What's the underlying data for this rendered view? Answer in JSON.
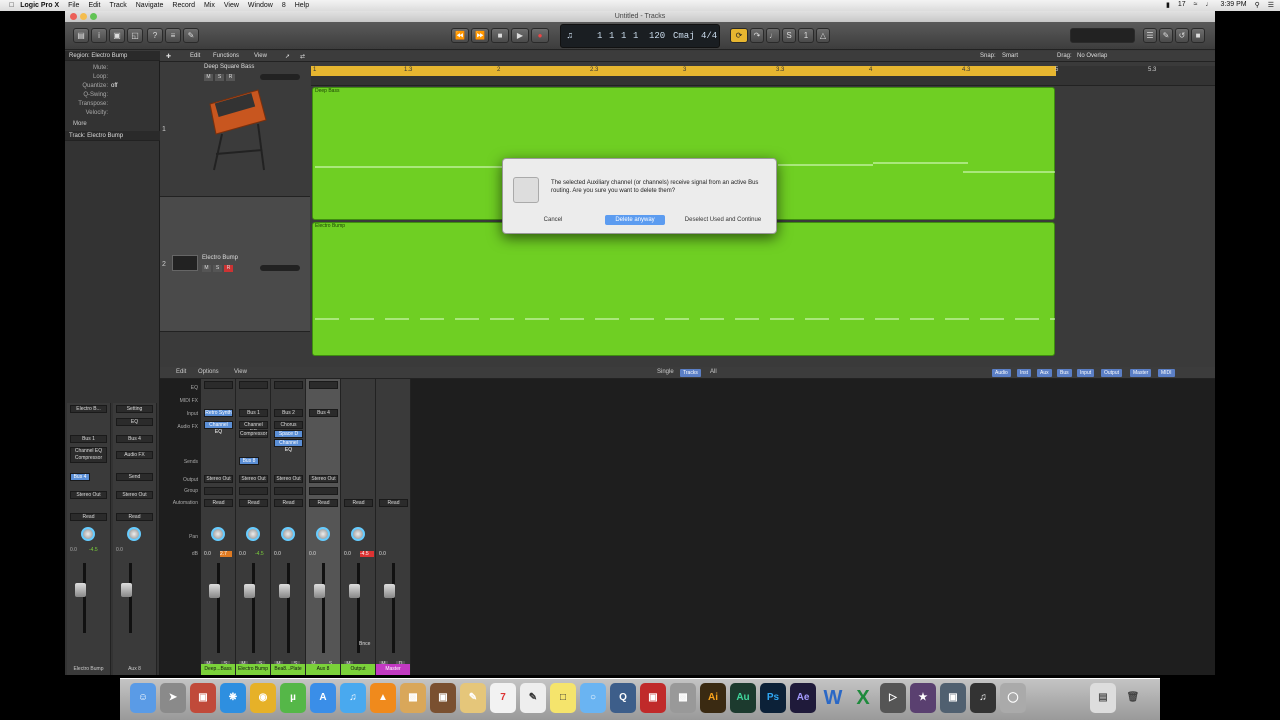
{
  "menubar": {
    "app": "Logic Pro X",
    "items": [
      "File",
      "Edit",
      "Track",
      "Navigate",
      "Record",
      "Mix",
      "View",
      "Window",
      "8",
      "Help"
    ],
    "status": {
      "battery": "17",
      "time": "3:39 PM"
    }
  },
  "window": {
    "title": "Untitled - Tracks"
  },
  "lcd": {
    "bar": "1",
    "beat": "1",
    "div": "1",
    "tick": "1",
    "tempo": "120",
    "key": "Cmaj",
    "sig": "4/4"
  },
  "inspector": {
    "region_header": "Region: Electro Bump",
    "params": [
      {
        "k": "Mute:",
        "v": ""
      },
      {
        "k": "Loop:",
        "v": ""
      },
      {
        "k": "Quantize:",
        "v": "off"
      },
      {
        "k": "Q-Swing:",
        "v": ""
      },
      {
        "k": "Transpose:",
        "v": ""
      },
      {
        "k": "Velocity:",
        "v": ""
      }
    ],
    "more": "More",
    "track_header": "Track: Electro Bump"
  },
  "tracks_header": {
    "edit": "Edit",
    "functions": "Functions",
    "view": "View",
    "snap_label": "Snap:",
    "snap_value": "Smart",
    "drag_label": "Drag:",
    "drag_value": "No Overlap"
  },
  "tracks": [
    {
      "index": "1",
      "name": "Deep Square Bass"
    },
    {
      "index": "2",
      "name": "Electro Bump"
    }
  ],
  "ruler_ticks": [
    "1",
    "1.3",
    "2",
    "2.3",
    "3",
    "3.3",
    "4",
    "4.3",
    "5",
    "5.3"
  ],
  "regions": [
    {
      "name": "Deep Bass"
    },
    {
      "name": "Electro Bump"
    }
  ],
  "dialog": {
    "message": "The selected Auxiliary channel (or channels) receive signal from an active Bus routing. Are you sure you want to delete them?",
    "cancel": "Cancel",
    "delete": "Delete anyway",
    "deselect": "Deselect Used and Continue"
  },
  "mixer_header": {
    "edit": "Edit",
    "options": "Options",
    "view": "View",
    "single": "Single",
    "tracks": "Tracks",
    "all": "All",
    "filters": [
      "Audio",
      "Inst",
      "Aux",
      "Bus",
      "Input",
      "Output",
      "Master",
      "MIDI"
    ]
  },
  "mixer_labels": [
    "EQ",
    "MIDI FX",
    "Input",
    "Audio FX",
    "Sends",
    "Output",
    "Group",
    "Automation",
    "Pan",
    "dB"
  ],
  "inspector_strips": [
    {
      "plugin": "Electro B...",
      "setting": "Setting",
      "eq": "EQ",
      "input": "Bus 1",
      "fx": "Channel EQ Compressor",
      "send": "Bus 4",
      "output": "Stereo Out",
      "auto": "Read",
      "db1": "0.0",
      "db2": "-4.5",
      "name": "Electro Bump"
    },
    {
      "plugin": "",
      "setting": "Setting",
      "eq": "EQ",
      "input": "Bus 4",
      "fx": "Audio FX",
      "send": "Send",
      "output": "Stereo Out",
      "auto": "Read",
      "db1": "0.0",
      "db2": "",
      "name": "Aux 8"
    }
  ],
  "strips": [
    {
      "input": "Retro Synth",
      "fx": [
        "Channel EQ"
      ],
      "send": "",
      "output": "Stereo Out",
      "auto": "Read",
      "db1": "0.0",
      "db2": "2.7",
      "name": "Deep...Bass",
      "color": "#7bd23a"
    },
    {
      "input": "Bus 1",
      "fx": [
        "Channel EQ",
        "Compressor"
      ],
      "send": "Bus 8",
      "output": "Stereo Out",
      "auto": "Read",
      "db1": "0.0",
      "db2": "-4.5",
      "name": "Electro Bump",
      "color": "#7bd23a"
    },
    {
      "input": "Bus 2",
      "fx": [
        "Chorus",
        "Space D",
        "Channel EQ"
      ],
      "send": "",
      "output": "Stereo Out",
      "auto": "Read",
      "db1": "0.0",
      "db2": "",
      "name": "Bea8...Plate",
      "color": "#7bd23a"
    },
    {
      "input": "Bus 4",
      "fx": [],
      "send": "",
      "output": "Stereo Out",
      "auto": "Read",
      "db1": "0.0",
      "db2": "",
      "name": "Aux 8",
      "color": "#7bd23a"
    },
    {
      "input": "",
      "fx": [],
      "send": "",
      "output": "",
      "auto": "Read",
      "db1": "0.0",
      "db2": "-4.5",
      "name": "Output",
      "color": "#7bd23a"
    },
    {
      "input": "",
      "fx": [],
      "send": "",
      "output": "",
      "auto": "Read",
      "db1": "0.0",
      "db2": "",
      "name": "Master",
      "color": "#c23ac2"
    }
  ],
  "bounce_label": "Bnce",
  "dock": [
    "Finder",
    "Launchpad",
    "Photo Booth",
    "Safari",
    "Chrome",
    "uTorrent",
    "App Store",
    "iTunes",
    "VLC",
    "Preview",
    "Photos",
    "Keynote",
    "Notes",
    "Calendar",
    "TextEdit",
    "Stickies",
    "Messages",
    "QuickTime",
    "Photo Booth",
    "Preview",
    "Ai",
    "Au",
    "Ps",
    "Ae",
    "W",
    "X",
    "Final Cut",
    "Motion",
    "Compressor",
    "Logic",
    "Disk",
    "Trash"
  ]
}
